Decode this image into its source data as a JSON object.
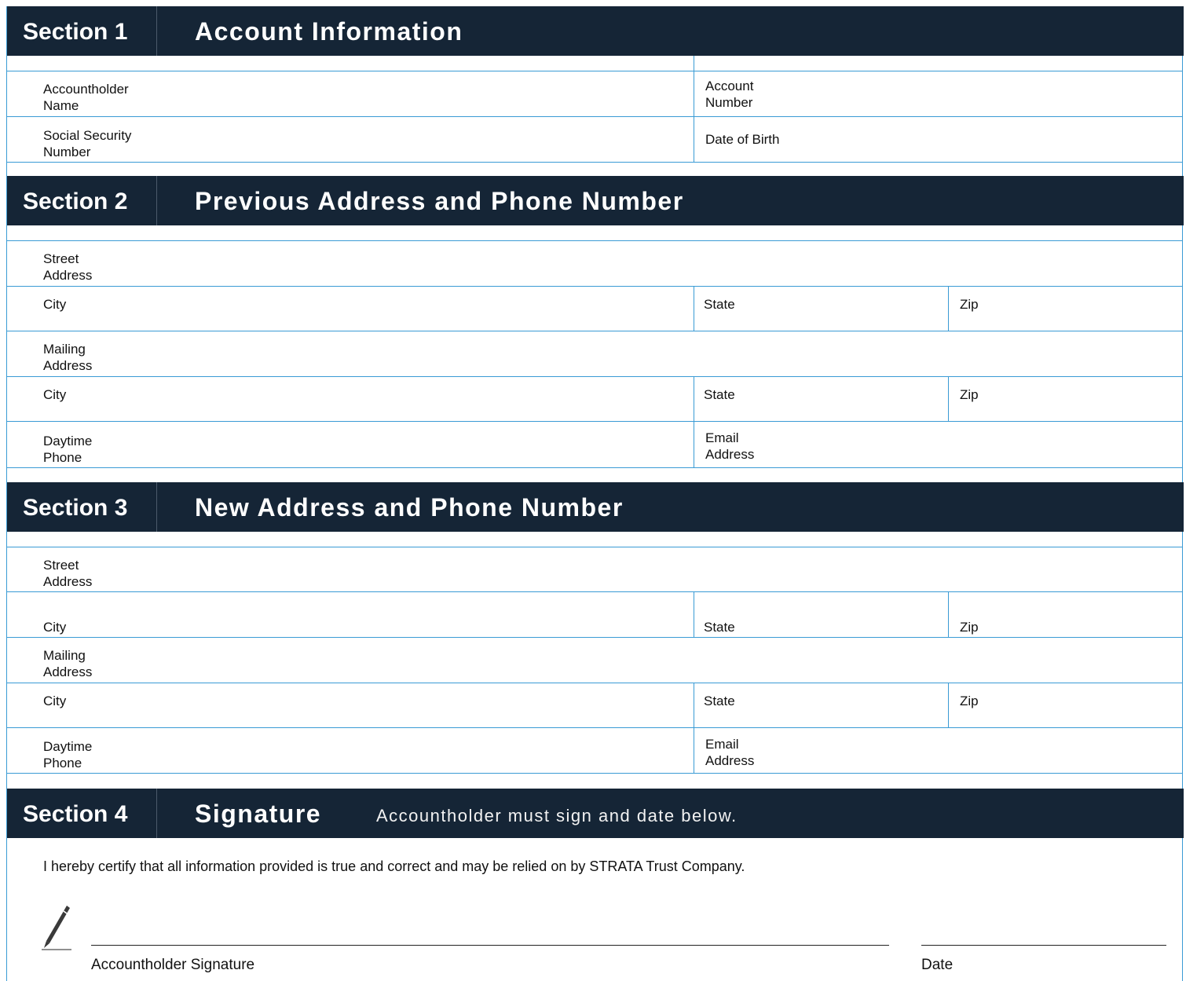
{
  "section1": {
    "number": "Section 1",
    "title": "Account Information",
    "fields": {
      "accountholder_name": "Accountholder\nName",
      "account_number": "Account\nNumber",
      "ssn": "Social Security\nNumber",
      "dob": "Date of Birth"
    }
  },
  "section2": {
    "number": "Section 2",
    "title": "Previous Address and Phone Number",
    "fields": {
      "street": "Street\nAddress",
      "city": "City",
      "state": "State",
      "zip": "Zip",
      "mailing": "Mailing\nAddress",
      "city2": "City",
      "state2": "State",
      "zip2": "Zip",
      "phone": "Daytime\nPhone",
      "email": "Email\nAddress"
    }
  },
  "section3": {
    "number": "Section 3",
    "title": "New Address and Phone Number",
    "fields": {
      "street": "Street\nAddress",
      "city": "City",
      "state": "State",
      "zip": "Zip",
      "mailing": "Mailing\nAddress",
      "city2": "City",
      "state2": "State",
      "zip2": "Zip",
      "phone": "Daytime\nPhone",
      "email": "Email\nAddress"
    }
  },
  "section4": {
    "number": "Section 4",
    "title": "Signature",
    "subtitle": "Accountholder must sign and date below.",
    "certification": "I hereby certify that all information provided is true and correct and may be relied on by STRATA Trust Company.",
    "signature_label": "Accountholder Signature",
    "date_label": "Date"
  },
  "icons": {
    "pen": "pen-icon"
  },
  "colors": {
    "header_bg": "#152536",
    "border": "#3a9bd5"
  }
}
